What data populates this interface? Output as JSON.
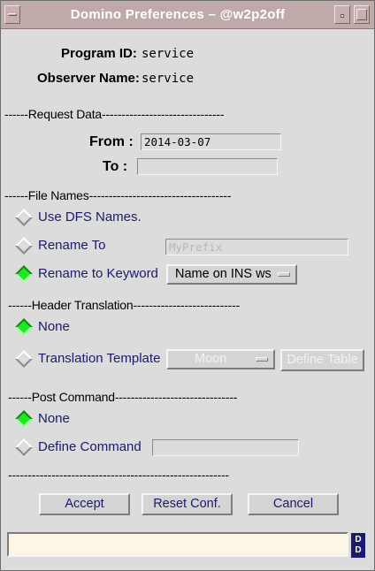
{
  "window": {
    "title": "Domino Preferences – @w2p2off"
  },
  "header": {
    "program_id_label": "Program ID:",
    "program_id_value": "service",
    "observer_label": "Observer Name:",
    "observer_value": "service"
  },
  "request_data": {
    "separator": "------Request Data-------------------------------",
    "from_label": "From :",
    "from_value": "2014-03-07",
    "to_label": "To :",
    "to_value": ""
  },
  "file_names": {
    "separator": "------File Names------------------------------------",
    "use_dfs_label": "Use DFS Names.",
    "rename_to_label": "Rename To",
    "rename_to_value": "MyPrefix",
    "rename_keyword_label": "Rename to Keyword",
    "keyword_menu_value": "Name on INS ws",
    "selected": "rename_keyword"
  },
  "header_translation": {
    "separator": "------Header Translation---------------------------",
    "none_label": "None",
    "template_label": "Translation Template",
    "template_menu_value": "Moon",
    "define_table_label": "Define Table",
    "selected": "none"
  },
  "post_command": {
    "separator": "------Post Command-------------------------------",
    "none_label": "None",
    "define_label": "Define Command",
    "define_value": "",
    "selected": "none"
  },
  "footer": {
    "separator": "--------------------------------------------------------",
    "accept_label": "Accept",
    "reset_label": "Reset Conf.",
    "cancel_label": "Cancel",
    "status_text": "",
    "logo_text": "D D"
  },
  "colors": {
    "titlebar": "#c0a9a9",
    "radio_on": "#22e622",
    "option_text": "#1a1a6e",
    "status_bg": "#fdf6e6"
  }
}
